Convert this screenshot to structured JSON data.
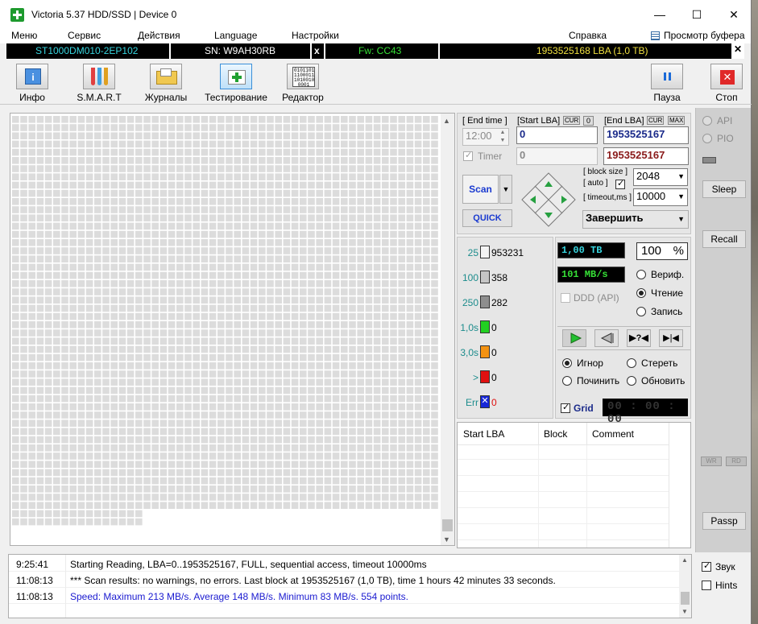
{
  "window": {
    "title": "Victoria 5.37 HDD/SSD | Device 0",
    "min": "—",
    "max": "☐",
    "close": "✕"
  },
  "menu": {
    "items": [
      "Меню",
      "Сервис",
      "Действия",
      "Language",
      "Настройки"
    ],
    "help": "Справка",
    "buffer": "Просмотр буфера"
  },
  "infobar": {
    "model": "ST1000DM010-2EP102",
    "serial": "SN: W9AH30RB",
    "x": "x",
    "firmware": "Fw: CC43",
    "lba": "1953525168 LBA (1,0 TB)"
  },
  "toolbar": {
    "info": "Инфо",
    "smart": "S.M.A.R.T",
    "logs": "Журналы",
    "test": "Тестирование",
    "editor": "Редактор",
    "pause": "Пауза",
    "stop": "Стоп"
  },
  "scan": {
    "end_time_label": "[ End time ]",
    "start_lba_label": "[Start LBA]",
    "cur": "CUR",
    "zero": "0",
    "end_lba_label": "[End LBA]",
    "max": "MAX",
    "time_value": "12:00",
    "start_lba": "0",
    "end_lba": "1953525167",
    "timer_label": "Timer",
    "start_lba2": "0",
    "end_lba2": "1953525167",
    "scan_btn": "Scan",
    "quick_btn": "QUICK",
    "block_size_label": "[ block size ]",
    "auto_label": "[ auto ]",
    "timeout_label": "[ timeout,ms ]",
    "block_size": "2048",
    "timeout": "10000",
    "action": "Завершить"
  },
  "stats": [
    {
      "label": "25",
      "count": "953231",
      "color": "#f4f4f4",
      "lcolor": "#1c8c8c",
      "ccolor": "#000"
    },
    {
      "label": "100",
      "count": "358",
      "color": "#c6c6c6",
      "lcolor": "#1c8c8c",
      "ccolor": "#000"
    },
    {
      "label": "250",
      "count": "282",
      "color": "#8e8e8e",
      "lcolor": "#1c8c8c",
      "ccolor": "#000"
    },
    {
      "label": "1,0s",
      "count": "0",
      "color": "#22d022",
      "lcolor": "#1c8c8c",
      "ccolor": "#000"
    },
    {
      "label": "3,0s",
      "count": "0",
      "color": "#f39212",
      "lcolor": "#1c8c8c",
      "ccolor": "#000"
    },
    {
      "label": ">",
      "count": "0",
      "color": "#e01010",
      "lcolor": "#1c8c8c",
      "ccolor": "#000"
    },
    {
      "label": "Err",
      "count": "0",
      "color": "#1828d8",
      "lcolor": "#1c8c8c",
      "ccolor": "#e01010"
    }
  ],
  "progress": {
    "size": "1,00 TB",
    "percent_value": "100",
    "percent_sign": "%",
    "speed": "101 MB/s",
    "ddd": "DDD (API)",
    "verify": "Вериф.",
    "read": "Чтение",
    "write": "Запись"
  },
  "mode": {
    "ignore": "Игнор",
    "erase": "Стереть",
    "repair": "Починить",
    "refresh": "Обновить",
    "grid": "Grid",
    "timer": "00 : 00 : 00"
  },
  "table": {
    "headers": [
      "Start LBA",
      "Block",
      "Comment"
    ]
  },
  "right": {
    "api": "API",
    "pio": "PIO",
    "sleep": "Sleep",
    "recall": "Recall",
    "wr": "WR",
    "rd": "RD",
    "passp": "Passp",
    "sound": "Звук",
    "hints": "Hints"
  },
  "log": [
    {
      "time": "9:25:41",
      "msg": "Starting Reading, LBA=0..1953525167, FULL, sequential access, timeout 10000ms",
      "color": "#000"
    },
    {
      "time": "11:08:13",
      "msg": "*** Scan results: no warnings, no errors. Last block at 1953525167 (1,0 TB), time 1 hours 42 minutes 33 seconds.",
      "color": "#000"
    },
    {
      "time": "11:08:13",
      "msg": "Speed: Maximum 213 MB/s. Average 148 MB/s. Minimum 83 MB/s. 554 points.",
      "color": "#1a1ad0"
    }
  ]
}
